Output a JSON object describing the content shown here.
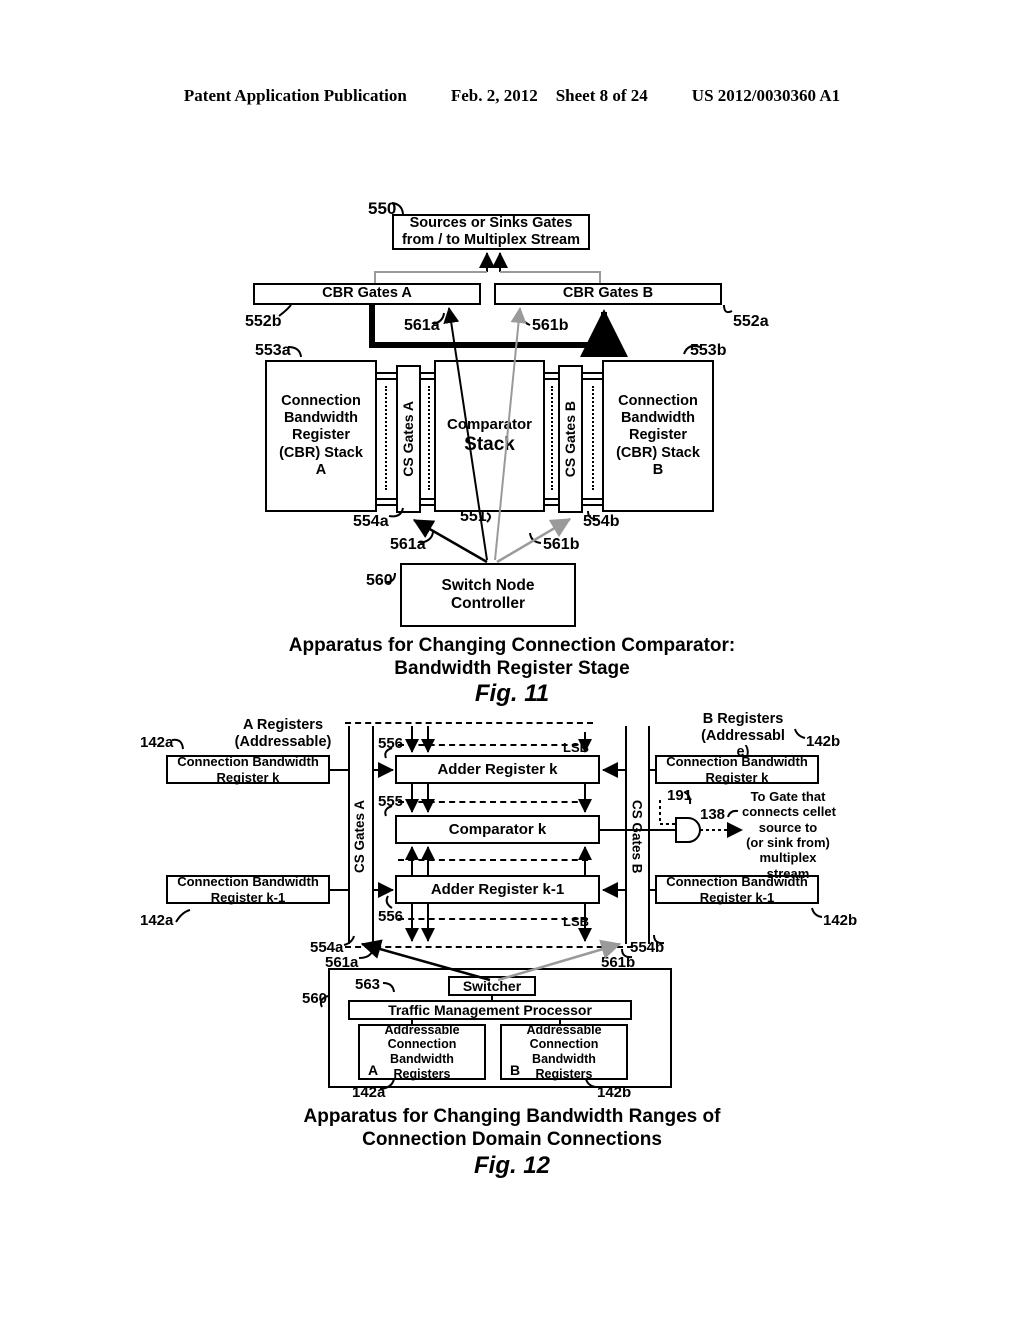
{
  "header": {
    "publication": "Patent Application Publication",
    "date": "Feb. 2, 2012",
    "sheet": "Sheet 8 of 24",
    "docnum": "US 2012/0030360 A1"
  },
  "fig11": {
    "number": "Fig. 11",
    "caption_line1": "Apparatus for Changing Connection Comparator:",
    "caption_line2": "Bandwidth Register Stage",
    "sources_box": "Sources or Sinks Gates\nfrom / to Multiplex Stream",
    "sources_ref": "550",
    "cbr_gates_a": "CBR Gates A",
    "cbr_gates_b": "CBR Gates B",
    "cbr_gates_a_ref": "552b",
    "cbr_gates_b_ref": "552a",
    "stack_a": "Connection\nBandwidth\nRegister\n(CBR) Stack\nA",
    "stack_b": "Connection\nBandwidth\nRegister\n(CBR) Stack\nB",
    "stack_a_ref": "553a",
    "stack_b_ref": "553b",
    "cs_gates_a": "CS Gates A",
    "cs_gates_b": "CS Gates B",
    "cs_gates_a_ref": "554a",
    "cs_gates_b_ref": "554b",
    "comparator_line1": "Comparator",
    "comparator_line2": "Stack",
    "comparator_ref": "551",
    "controller": "Switch Node\nController",
    "controller_ref": "560",
    "sig_561a_top": "561a",
    "sig_561b_top": "561b",
    "sig_561a_bot": "561a",
    "sig_561b_bot": "561b"
  },
  "fig12": {
    "number": "Fig. 12",
    "caption_line1": "Apparatus for Changing Bandwidth Ranges of",
    "caption_line2": "Connection Domain Connections",
    "a_registers_title": "A Registers\n(Addressable)",
    "b_registers_title": "B Registers\n(Addressabl\ne)",
    "left_reg_k": "Connection Bandwidth\nRegister k",
    "left_reg_k1": "Connection Bandwidth\nRegister k-1",
    "right_reg_k": "Connection Bandwidth\nRegister k",
    "right_reg_k1": "Connection Bandwidth\nRegister k-1",
    "ref_142a_top": "142a",
    "ref_142a_bot": "142a",
    "ref_142b_top": "142b",
    "ref_142b_bot": "142b",
    "adder_k": "Adder Register k",
    "adder_k1": "Adder Register k-1",
    "comparator_k": "Comparator k",
    "ref_556_top": "556",
    "ref_556_bot": "556",
    "ref_555": "555",
    "lsb_top": "LSB",
    "lsb_bot": "LSB",
    "cs_gates_a": "CS Gates A",
    "cs_gates_b": "CS Gates B",
    "ref_554a": "554a",
    "ref_554b": "554b",
    "ref_561a": "561a",
    "ref_561b": "561b",
    "gate_ref_191": "191",
    "gate_ref_138": "138",
    "gate_text": "To Gate that\nconnects cellet\nsource to\n(or sink from)\nmultiplex\nstream",
    "switcher": "Switcher",
    "switcher_ref": "563",
    "tmp": "Traffic Management Processor",
    "controller_ref": "560",
    "acbr_a": "Addressable\nConnection\nBandwidth\nRegisters",
    "acbr_b": "Addressable\nConnection\nBandwidth\nRegisters",
    "acbr_a_letter": "A",
    "acbr_b_letter": "B",
    "acbr_a_ref": "142a",
    "acbr_b_ref": "142b"
  }
}
